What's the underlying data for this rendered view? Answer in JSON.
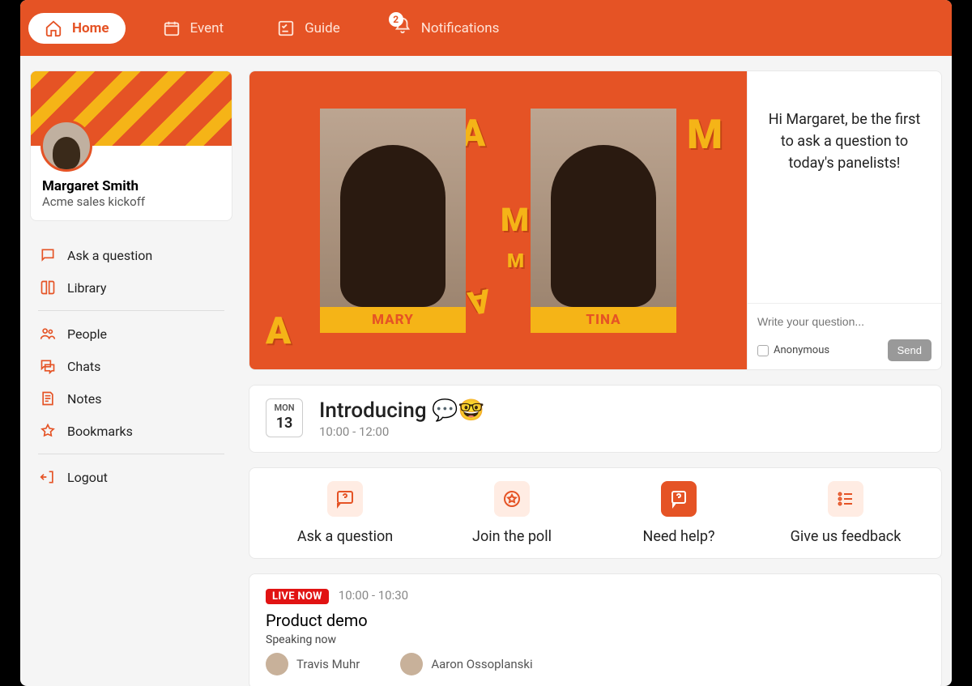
{
  "nav": {
    "home": "Home",
    "event": "Event",
    "guide": "Guide",
    "notifications": "Notifications",
    "notif_count": "2"
  },
  "profile": {
    "name": "Margaret Smith",
    "sub": "Acme sales kickoff"
  },
  "menu": {
    "ask": "Ask a question",
    "library": "Library",
    "people": "People",
    "chats": "Chats",
    "notes": "Notes",
    "bookmarks": "Bookmarks",
    "logout": "Logout"
  },
  "hero": {
    "panelists": [
      "MARY",
      "TINA"
    ],
    "prompt": "Hi Margaret, be the first to ask a question to today's panelists!",
    "placeholder": "Write your question...",
    "anonymous": "Anonymous",
    "send": "Send"
  },
  "session": {
    "dow": "MON",
    "dom": "13",
    "title": "Introducing 💬🤓",
    "time": "10:00 - 12:00"
  },
  "actions": {
    "ask": "Ask a question",
    "poll": "Join the poll",
    "help": "Need help?",
    "feedback": "Give us feedback"
  },
  "live": {
    "badge": "LIVE NOW",
    "time": "10:00 - 10:30",
    "title": "Product demo",
    "speaking_label": "Speaking now",
    "speakers": [
      "Travis Muhr",
      "Aaron Ossoplanski"
    ]
  }
}
